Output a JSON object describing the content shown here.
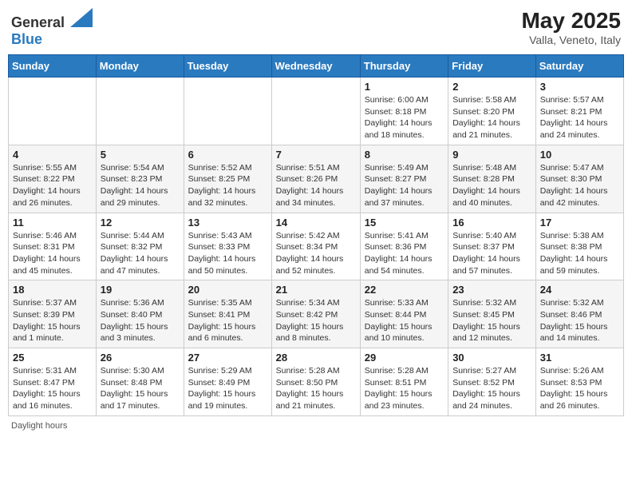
{
  "header": {
    "logo_general": "General",
    "logo_blue": "Blue",
    "title": "May 2025",
    "location": "Valla, Veneto, Italy"
  },
  "days_of_week": [
    "Sunday",
    "Monday",
    "Tuesday",
    "Wednesday",
    "Thursday",
    "Friday",
    "Saturday"
  ],
  "weeks": [
    [
      {
        "day": "",
        "info": ""
      },
      {
        "day": "",
        "info": ""
      },
      {
        "day": "",
        "info": ""
      },
      {
        "day": "",
        "info": ""
      },
      {
        "day": "1",
        "info": "Sunrise: 6:00 AM\nSunset: 8:18 PM\nDaylight: 14 hours\nand 18 minutes."
      },
      {
        "day": "2",
        "info": "Sunrise: 5:58 AM\nSunset: 8:20 PM\nDaylight: 14 hours\nand 21 minutes."
      },
      {
        "day": "3",
        "info": "Sunrise: 5:57 AM\nSunset: 8:21 PM\nDaylight: 14 hours\nand 24 minutes."
      }
    ],
    [
      {
        "day": "4",
        "info": "Sunrise: 5:55 AM\nSunset: 8:22 PM\nDaylight: 14 hours\nand 26 minutes."
      },
      {
        "day": "5",
        "info": "Sunrise: 5:54 AM\nSunset: 8:23 PM\nDaylight: 14 hours\nand 29 minutes."
      },
      {
        "day": "6",
        "info": "Sunrise: 5:52 AM\nSunset: 8:25 PM\nDaylight: 14 hours\nand 32 minutes."
      },
      {
        "day": "7",
        "info": "Sunrise: 5:51 AM\nSunset: 8:26 PM\nDaylight: 14 hours\nand 34 minutes."
      },
      {
        "day": "8",
        "info": "Sunrise: 5:49 AM\nSunset: 8:27 PM\nDaylight: 14 hours\nand 37 minutes."
      },
      {
        "day": "9",
        "info": "Sunrise: 5:48 AM\nSunset: 8:28 PM\nDaylight: 14 hours\nand 40 minutes."
      },
      {
        "day": "10",
        "info": "Sunrise: 5:47 AM\nSunset: 8:30 PM\nDaylight: 14 hours\nand 42 minutes."
      }
    ],
    [
      {
        "day": "11",
        "info": "Sunrise: 5:46 AM\nSunset: 8:31 PM\nDaylight: 14 hours\nand 45 minutes."
      },
      {
        "day": "12",
        "info": "Sunrise: 5:44 AM\nSunset: 8:32 PM\nDaylight: 14 hours\nand 47 minutes."
      },
      {
        "day": "13",
        "info": "Sunrise: 5:43 AM\nSunset: 8:33 PM\nDaylight: 14 hours\nand 50 minutes."
      },
      {
        "day": "14",
        "info": "Sunrise: 5:42 AM\nSunset: 8:34 PM\nDaylight: 14 hours\nand 52 minutes."
      },
      {
        "day": "15",
        "info": "Sunrise: 5:41 AM\nSunset: 8:36 PM\nDaylight: 14 hours\nand 54 minutes."
      },
      {
        "day": "16",
        "info": "Sunrise: 5:40 AM\nSunset: 8:37 PM\nDaylight: 14 hours\nand 57 minutes."
      },
      {
        "day": "17",
        "info": "Sunrise: 5:38 AM\nSunset: 8:38 PM\nDaylight: 14 hours\nand 59 minutes."
      }
    ],
    [
      {
        "day": "18",
        "info": "Sunrise: 5:37 AM\nSunset: 8:39 PM\nDaylight: 15 hours\nand 1 minute."
      },
      {
        "day": "19",
        "info": "Sunrise: 5:36 AM\nSunset: 8:40 PM\nDaylight: 15 hours\nand 3 minutes."
      },
      {
        "day": "20",
        "info": "Sunrise: 5:35 AM\nSunset: 8:41 PM\nDaylight: 15 hours\nand 6 minutes."
      },
      {
        "day": "21",
        "info": "Sunrise: 5:34 AM\nSunset: 8:42 PM\nDaylight: 15 hours\nand 8 minutes."
      },
      {
        "day": "22",
        "info": "Sunrise: 5:33 AM\nSunset: 8:44 PM\nDaylight: 15 hours\nand 10 minutes."
      },
      {
        "day": "23",
        "info": "Sunrise: 5:32 AM\nSunset: 8:45 PM\nDaylight: 15 hours\nand 12 minutes."
      },
      {
        "day": "24",
        "info": "Sunrise: 5:32 AM\nSunset: 8:46 PM\nDaylight: 15 hours\nand 14 minutes."
      }
    ],
    [
      {
        "day": "25",
        "info": "Sunrise: 5:31 AM\nSunset: 8:47 PM\nDaylight: 15 hours\nand 16 minutes."
      },
      {
        "day": "26",
        "info": "Sunrise: 5:30 AM\nSunset: 8:48 PM\nDaylight: 15 hours\nand 17 minutes."
      },
      {
        "day": "27",
        "info": "Sunrise: 5:29 AM\nSunset: 8:49 PM\nDaylight: 15 hours\nand 19 minutes."
      },
      {
        "day": "28",
        "info": "Sunrise: 5:28 AM\nSunset: 8:50 PM\nDaylight: 15 hours\nand 21 minutes."
      },
      {
        "day": "29",
        "info": "Sunrise: 5:28 AM\nSunset: 8:51 PM\nDaylight: 15 hours\nand 23 minutes."
      },
      {
        "day": "30",
        "info": "Sunrise: 5:27 AM\nSunset: 8:52 PM\nDaylight: 15 hours\nand 24 minutes."
      },
      {
        "day": "31",
        "info": "Sunrise: 5:26 AM\nSunset: 8:53 PM\nDaylight: 15 hours\nand 26 minutes."
      }
    ]
  ],
  "footer": {
    "note": "Daylight hours"
  }
}
